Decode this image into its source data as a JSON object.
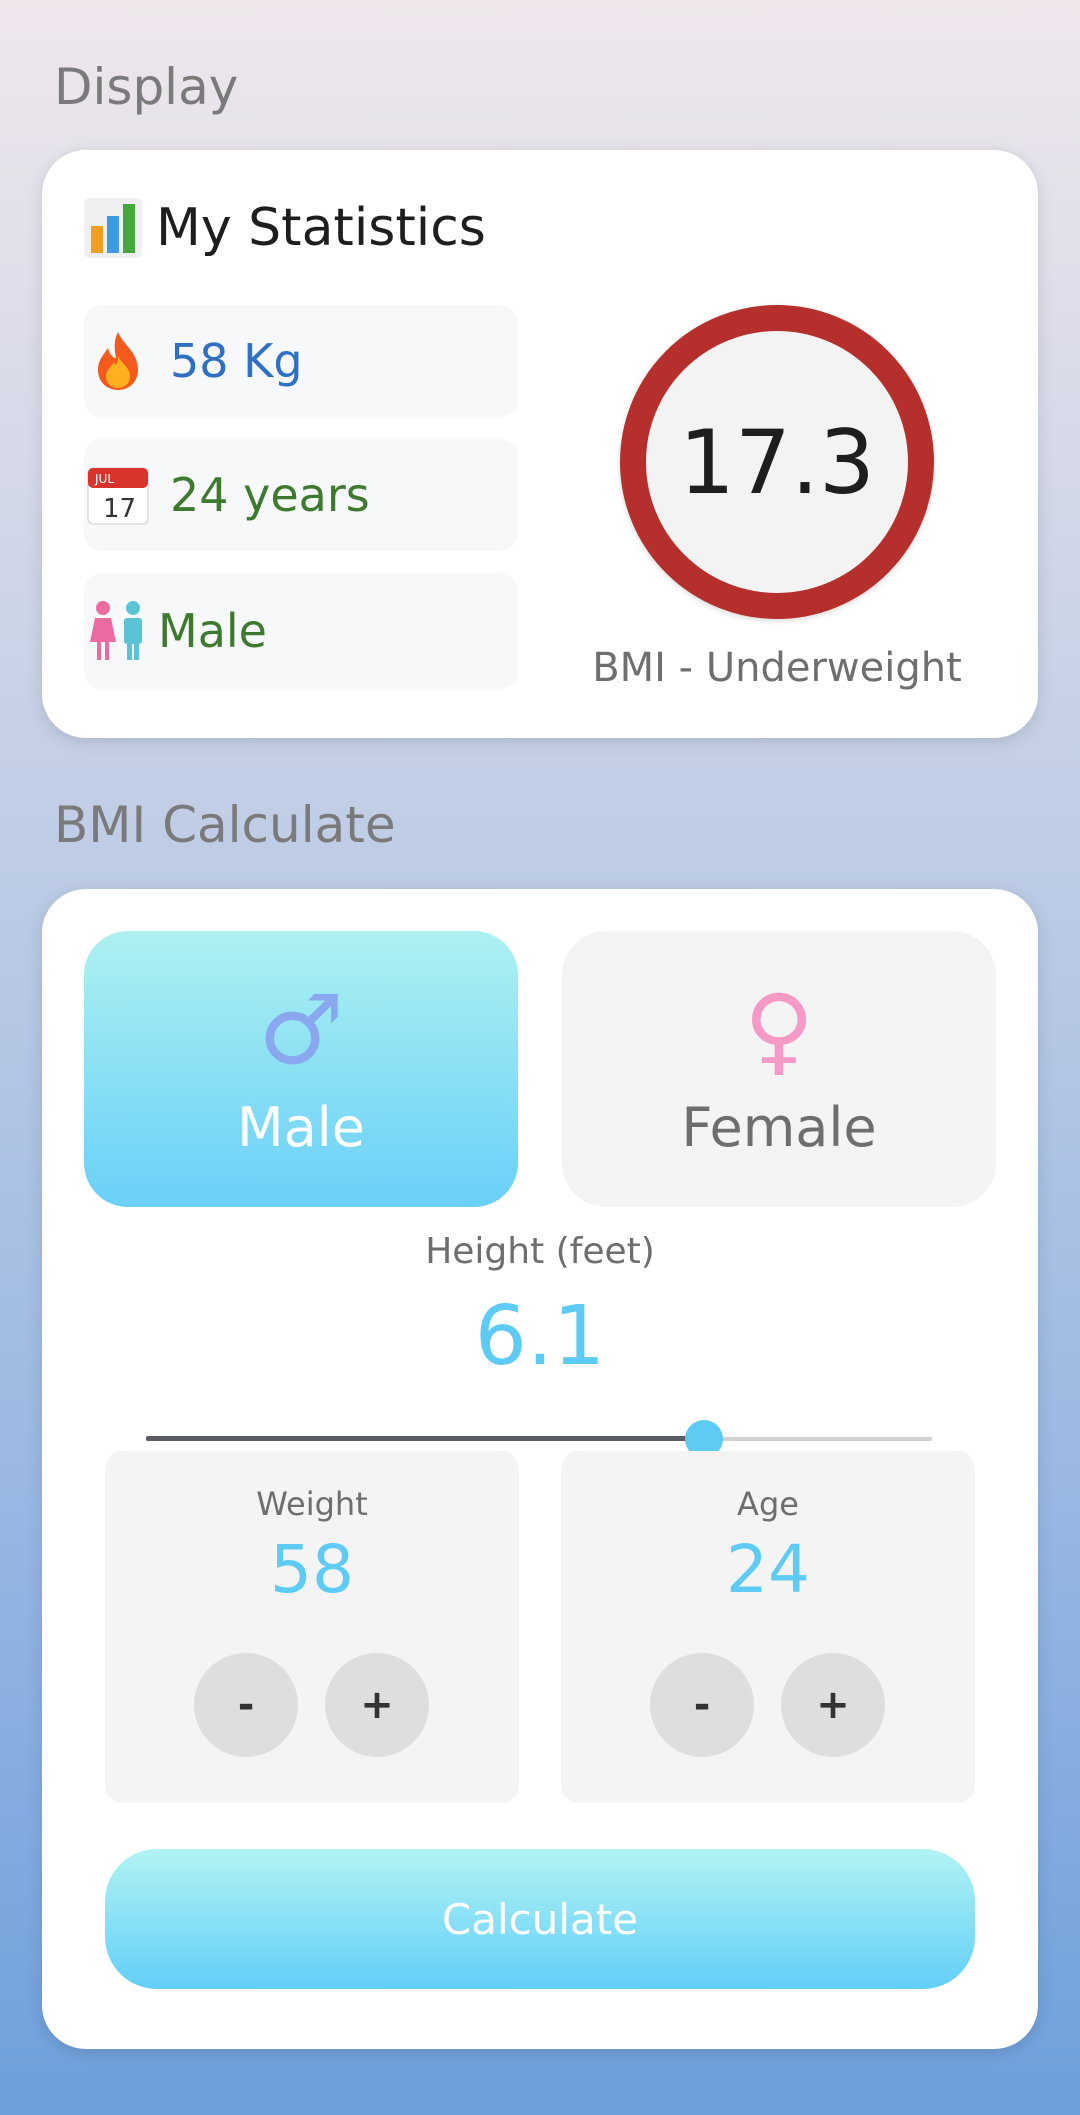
{
  "display": {
    "section_title": "Display",
    "stats_title": "My Statistics",
    "weight": "58 Kg",
    "age": "24 years",
    "gender": "Male",
    "bmi_value": "17.3",
    "bmi_caption": "BMI - Underweight",
    "icons": [
      "bar-chart-icon",
      "fire-icon",
      "calendar-icon",
      "people-icon"
    ],
    "calendar_month": "JUL",
    "calendar_day": "17",
    "colors": {
      "weight": "#2f6fc4",
      "age": "#3d7a2e",
      "gender": "#3d7a2e",
      "ring": "#b5302d"
    }
  },
  "calculator": {
    "section_title": "BMI Calculate",
    "male_label": "Male",
    "female_label": "Female",
    "male_glyph": "♂",
    "female_glyph": "♀",
    "selected_gender": "Male",
    "height_label": "Height (feet)",
    "height_value": "6.1",
    "height_slider_fraction": 0.71,
    "weight_label": "Weight",
    "weight_value": "58",
    "age_label": "Age",
    "age_value": "24",
    "minus_label": "-",
    "plus_label": "+",
    "calculate_label": "Calculate",
    "colors": {
      "accent": "#5ecbf4"
    }
  }
}
